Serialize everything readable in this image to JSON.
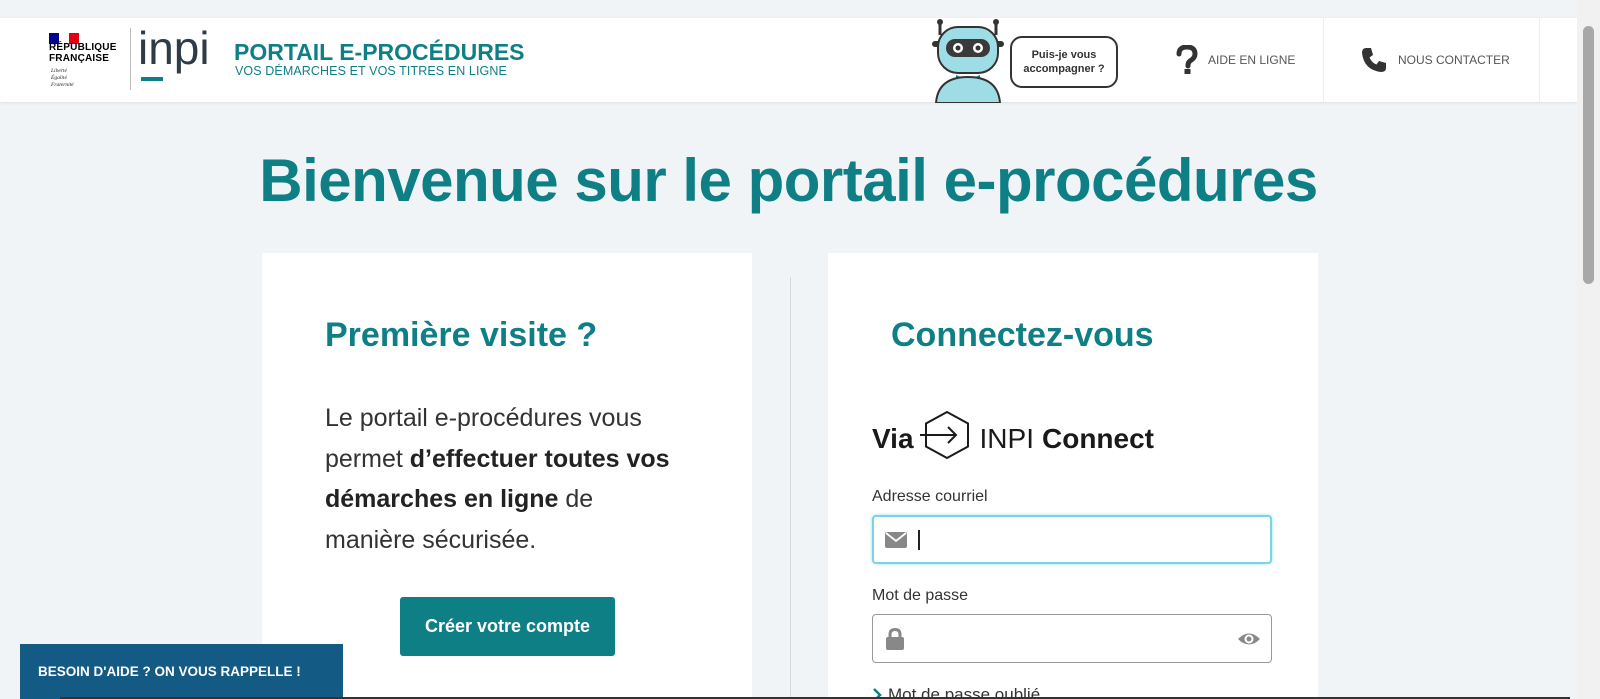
{
  "header": {
    "republique_lines": [
      "RÉPUBLIQUE",
      "FRANÇAISE"
    ],
    "motto_lines": [
      "Liberté",
      "Égalité",
      "Fraternité"
    ],
    "inpi_logo_text": "inpi",
    "portail_title": "PORTAIL E-PROCÉDURES",
    "portail_subtitle": "VOS DÉMARCHES ET VOS TITRES EN LIGNE",
    "chatbot_bubble": "Puis-je vous accompagner ?",
    "nav": {
      "help_label": "AIDE EN LIGNE",
      "contact_label": "NOUS CONTACTER"
    }
  },
  "colors": {
    "brand_teal": "#0f7f86",
    "callback_blue": "#135a84",
    "flag_blue": "#000091",
    "flag_red": "#e1000f"
  },
  "main": {
    "welcome_title": "Bienvenue sur le portail e-procédures"
  },
  "first_visit": {
    "title": "Première visite ?",
    "text_part1": "Le portail e-procédures vous permet ",
    "text_bold": "d’effectuer toutes vos démarches en ligne",
    "text_part2": " de manière sécurisée.",
    "create_button": "Créer votre compte"
  },
  "login": {
    "title": "Connectez-vous",
    "via_word": "Via",
    "inpi_word": "INPI",
    "connect_word": "Connect",
    "email_label": "Adresse courriel",
    "email_value": "",
    "password_label": "Mot de passe",
    "password_value": "",
    "forgot_label": "Mot de passe oublié"
  },
  "icons": {
    "email": "envelope-icon",
    "password": "lock-icon",
    "show_password": "eye-icon",
    "help": "question-mark-icon",
    "contact": "phone-icon",
    "inpi_connect": "inpi-connect-icon",
    "forgot": "chevron-right-icon"
  },
  "callback_banner": "BESOIN D'AIDE ? ON VOUS RAPPELLE !"
}
